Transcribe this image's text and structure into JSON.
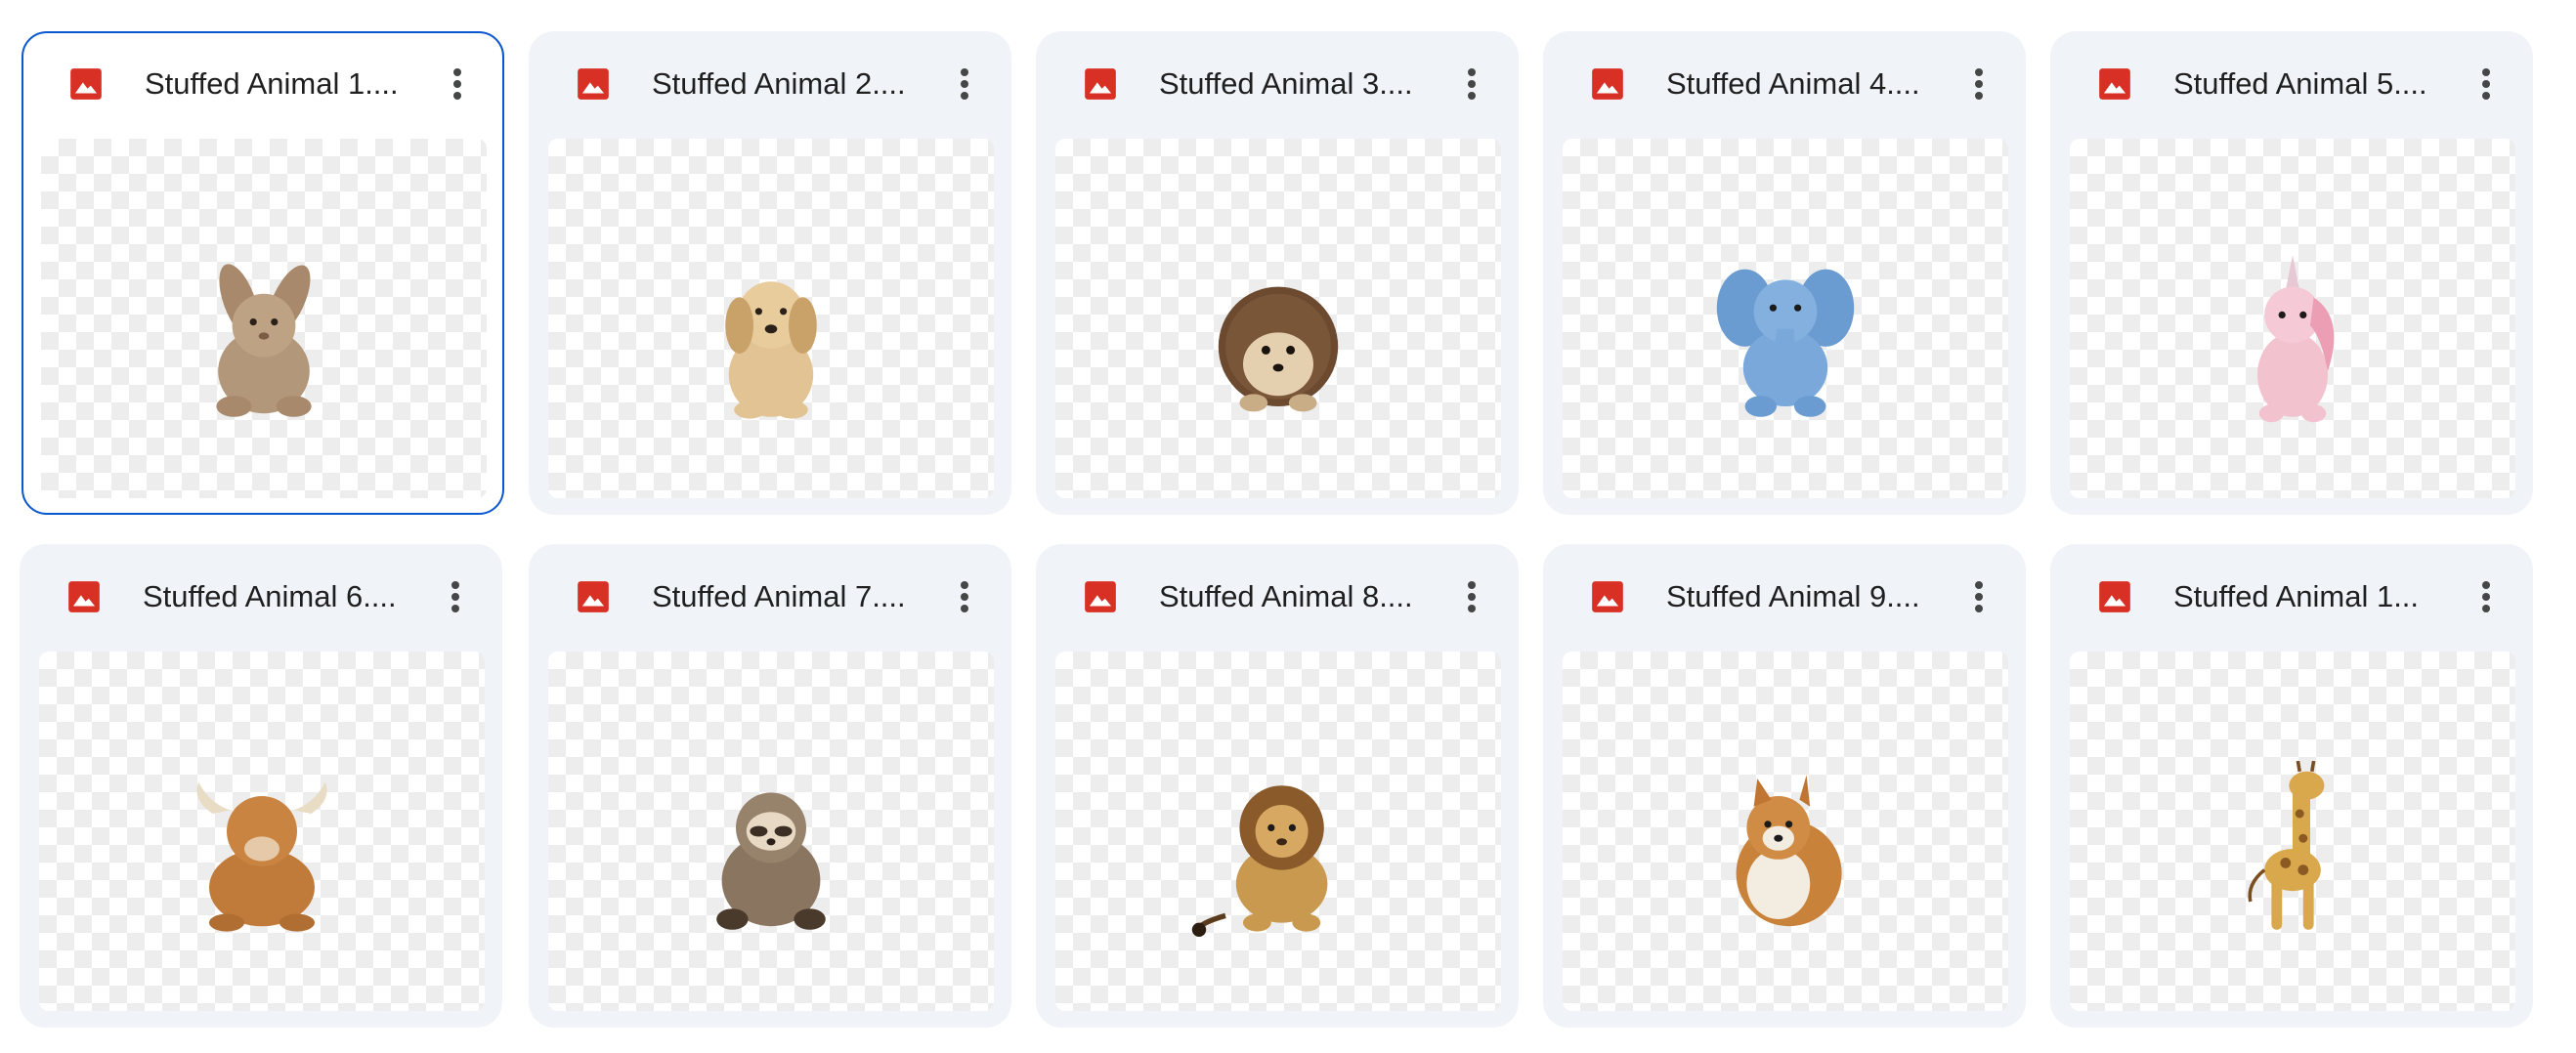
{
  "files": [
    {
      "name": "Stuffed Animal 1....",
      "icon": "image-file-icon",
      "preview": "bunny",
      "selected": true
    },
    {
      "name": "Stuffed Animal 2....",
      "icon": "image-file-icon",
      "preview": "puppy",
      "selected": false
    },
    {
      "name": "Stuffed Animal 3....",
      "icon": "image-file-icon",
      "preview": "hedgehog",
      "selected": false
    },
    {
      "name": "Stuffed Animal 4....",
      "icon": "image-file-icon",
      "preview": "elephant",
      "selected": false
    },
    {
      "name": "Stuffed Animal 5....",
      "icon": "image-file-icon",
      "preview": "unicorn",
      "selected": false
    },
    {
      "name": "Stuffed Animal 6....",
      "icon": "image-file-icon",
      "preview": "highland-cow",
      "selected": false
    },
    {
      "name": "Stuffed Animal 7....",
      "icon": "image-file-icon",
      "preview": "sloth",
      "selected": false
    },
    {
      "name": "Stuffed Animal 8....",
      "icon": "image-file-icon",
      "preview": "lion",
      "selected": false
    },
    {
      "name": "Stuffed Animal 9....",
      "icon": "image-file-icon",
      "preview": "pomeranian",
      "selected": false
    },
    {
      "name": "Stuffed Animal 1...",
      "icon": "image-file-icon",
      "preview": "giraffe",
      "selected": false
    }
  ],
  "colors": {
    "card_bg": "#f0f4f9",
    "selected_border": "#0b57d0",
    "image_icon": "#d93025",
    "title_text": "#1f1f1f",
    "more_icon": "#444746"
  }
}
